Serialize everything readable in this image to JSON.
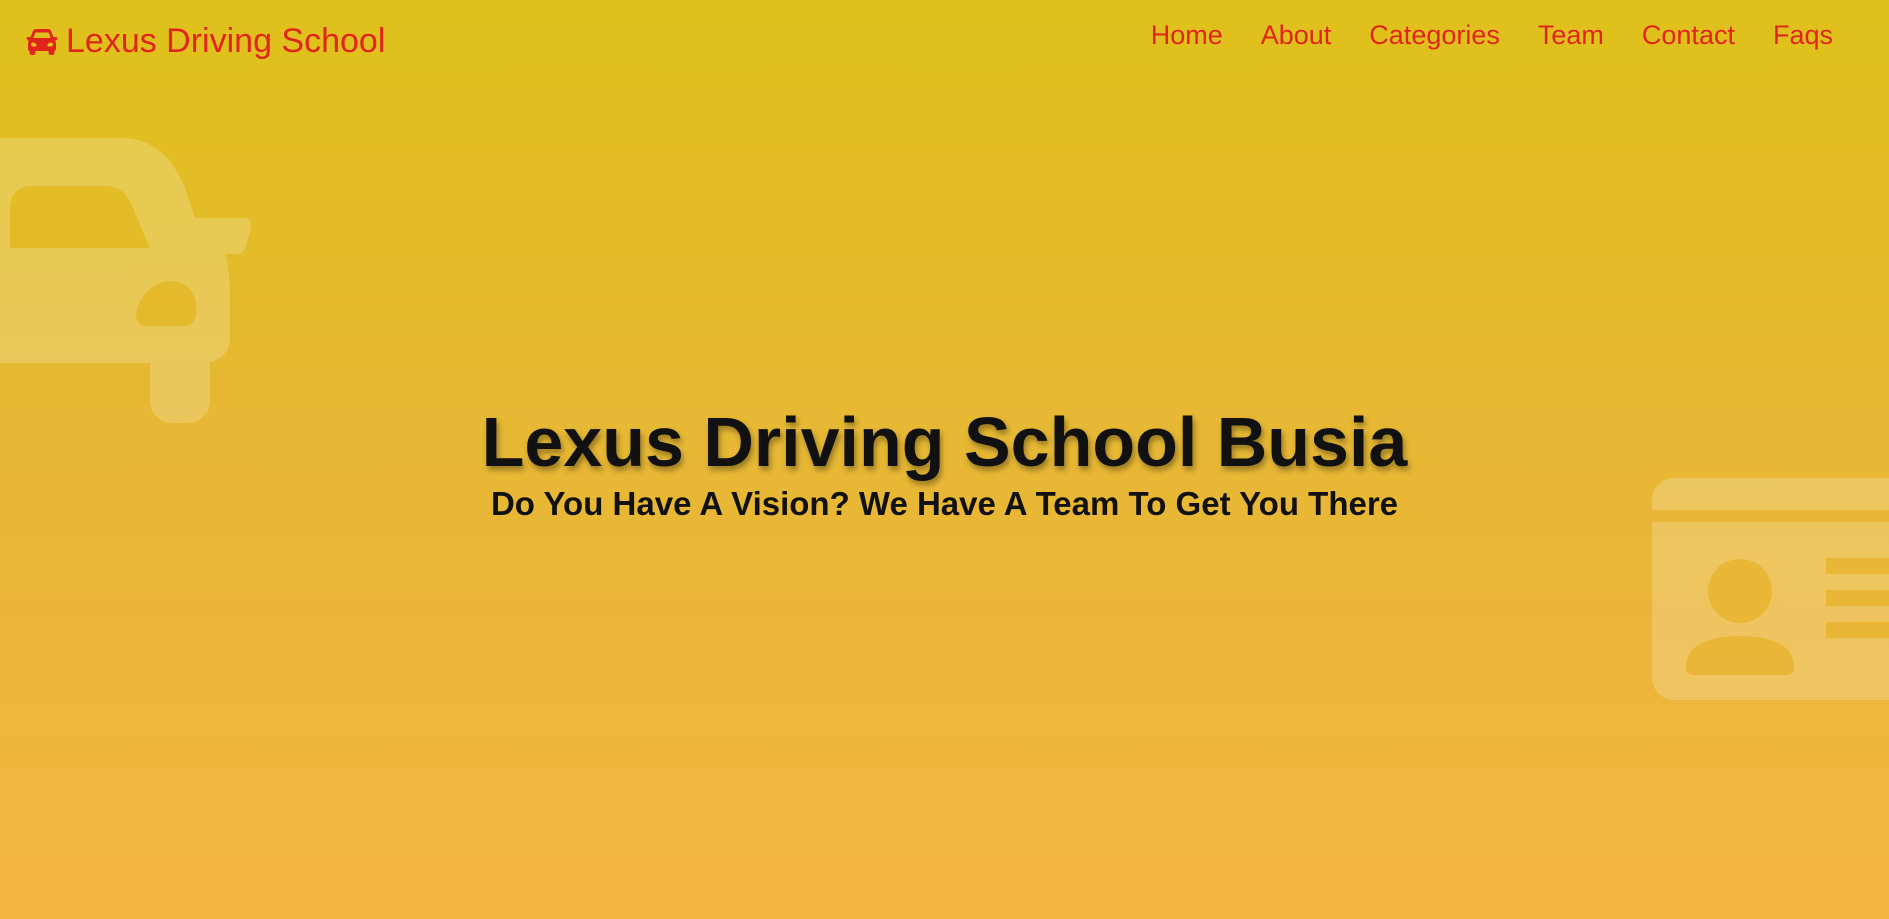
{
  "brand": {
    "name": "Lexus Driving School",
    "icon": "car-icon",
    "color": "#e0261b"
  },
  "nav": {
    "items": [
      {
        "label": "Home"
      },
      {
        "label": "About"
      },
      {
        "label": "Categories"
      },
      {
        "label": "Team"
      },
      {
        "label": "Contact"
      },
      {
        "label": "Faqs"
      }
    ]
  },
  "hero": {
    "title": "Lexus Driving School Busia",
    "subtitle": "Do You Have A Vision? We Have A Team To Get You There"
  },
  "background": {
    "gradient_top": "#dfc11a",
    "gradient_bottom": "#f3b43f",
    "decorations": [
      "car-icon",
      "id-card-icon"
    ]
  }
}
